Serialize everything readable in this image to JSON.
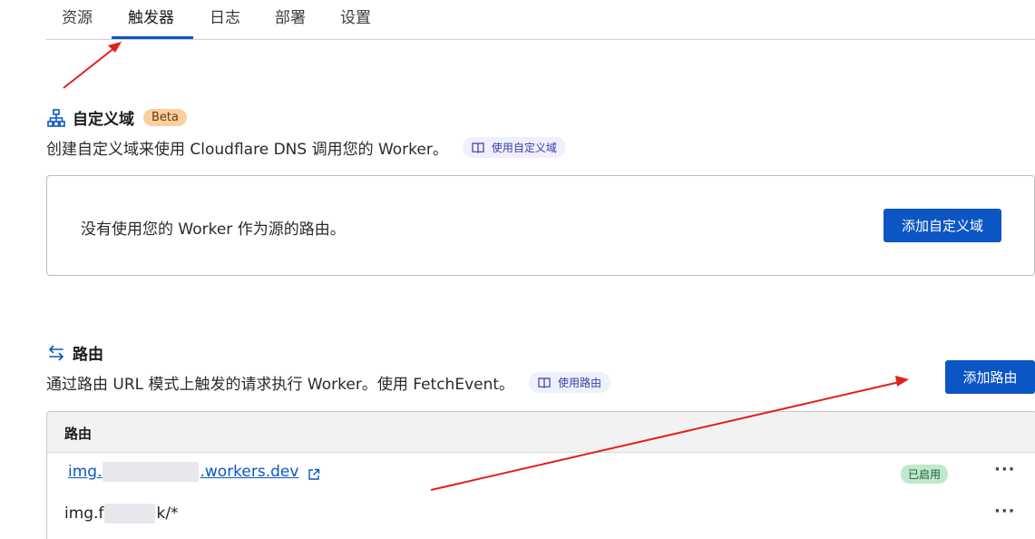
{
  "tabs": [
    {
      "label": "资源"
    },
    {
      "label": "触发器"
    },
    {
      "label": "日志"
    },
    {
      "label": "部署"
    },
    {
      "label": "设置"
    }
  ],
  "active_tab": "触发器",
  "custom_domains": {
    "title": "自定义域",
    "badge": "Beta",
    "description": "创建自定义域来使用 Cloudflare DNS 调用您的 Worker。",
    "doc_link": "使用自定义域",
    "empty_message": "没有使用您的 Worker 作为源的路由。",
    "add_button": "添加自定义域"
  },
  "routes": {
    "title": "路由",
    "description": "通过路由 URL 模式上触发的请求执行 Worker。使用 FetchEvent。",
    "doc_link": "使用路由",
    "add_button": "添加路由",
    "column_header": "路由",
    "rows": [
      {
        "prefix": "img.",
        "suffix": ".workers.dev",
        "status": "已启用",
        "more": "···"
      },
      {
        "prefix": "img.f",
        "suffix": "k/*",
        "more": "···"
      }
    ]
  },
  "colors": {
    "accent": "#0b55c4",
    "annotation_arrow": "#e02020"
  }
}
